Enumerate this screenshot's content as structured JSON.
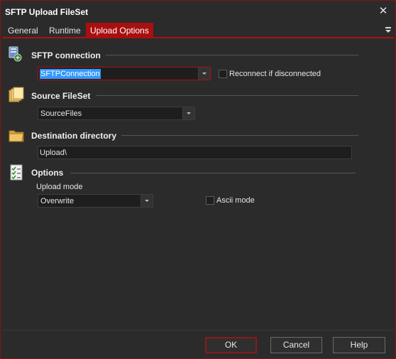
{
  "window": {
    "title": "SFTP Upload FileSet",
    "close_label": "✕"
  },
  "tabs": [
    {
      "label": "General"
    },
    {
      "label": "Runtime"
    },
    {
      "label": "Upload Options"
    }
  ],
  "active_tab": "Upload Options",
  "sftp": {
    "heading": "SFTP connection",
    "connection_value": "SFTPConnection",
    "reconnect_label": "Reconnect if disconnected",
    "reconnect_checked": false
  },
  "source": {
    "heading": "Source FileSet",
    "fileset_value": "SourceFiles"
  },
  "destination": {
    "heading": "Destination directory",
    "directory_value": "Upload\\"
  },
  "options": {
    "heading": "Options",
    "upload_mode_label": "Upload mode",
    "upload_mode_value": "Overwrite",
    "ascii_label": "Ascii mode",
    "ascii_checked": false
  },
  "buttons": {
    "ok": "OK",
    "cancel": "Cancel",
    "help": "Help"
  },
  "colors": {
    "accent": "#a80f0f",
    "selection": "#3399ff",
    "background": "#2b2b2b"
  }
}
